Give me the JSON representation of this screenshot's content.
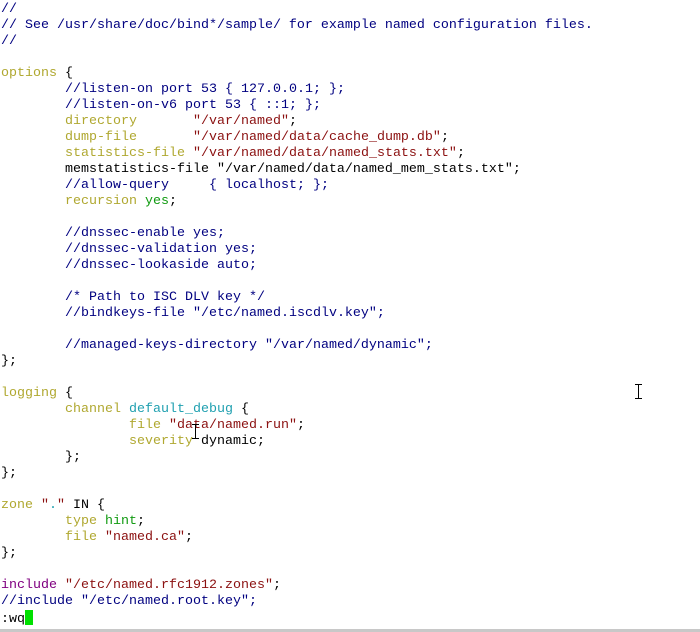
{
  "colors": {
    "n": "#000000",
    "cm": "#000080",
    "kw": "#b0a830",
    "st": "#8b1010",
    "ty": "#109a10",
    "id": "#20a0b0",
    "pp": "#800080",
    "cursor": "#00e000"
  },
  "editor": {
    "lines": [
      [
        [
          "cm",
          "//"
        ]
      ],
      [
        [
          "cm",
          "// See /usr/share/doc/bind*/sample/ for example named configuration files."
        ]
      ],
      [
        [
          "cm",
          "//"
        ]
      ],
      [],
      [
        [
          "kw",
          "options"
        ],
        [
          "n",
          " {"
        ]
      ],
      [
        [
          "n",
          "        "
        ],
        [
          "cm",
          "//listen-on port 53 { 127.0.0.1; };"
        ]
      ],
      [
        [
          "n",
          "        "
        ],
        [
          "cm",
          "//listen-on-v6 port 53 { ::1; };"
        ]
      ],
      [
        [
          "n",
          "        "
        ],
        [
          "kw",
          "directory"
        ],
        [
          "n",
          "       "
        ],
        [
          "st",
          "\"/var/named\""
        ],
        [
          "n",
          ";"
        ]
      ],
      [
        [
          "n",
          "        "
        ],
        [
          "kw",
          "dump-file"
        ],
        [
          "n",
          "       "
        ],
        [
          "st",
          "\"/var/named/data/cache_dump.db\""
        ],
        [
          "n",
          ";"
        ]
      ],
      [
        [
          "n",
          "        "
        ],
        [
          "kw",
          "statistics-file"
        ],
        [
          "n",
          " "
        ],
        [
          "st",
          "\"/var/named/data/named_stats.txt\""
        ],
        [
          "n",
          ";"
        ]
      ],
      [
        [
          "n",
          "        memstatistics-file \"/var/named/data/named_mem_stats.txt\";"
        ]
      ],
      [
        [
          "n",
          "        "
        ],
        [
          "cm",
          "//allow-query     { localhost; };"
        ]
      ],
      [
        [
          "n",
          "        "
        ],
        [
          "kw",
          "recursion"
        ],
        [
          "n",
          " "
        ],
        [
          "ty",
          "yes"
        ],
        [
          "n",
          ";"
        ]
      ],
      [],
      [
        [
          "n",
          "        "
        ],
        [
          "cm",
          "//dnssec-enable yes;"
        ]
      ],
      [
        [
          "n",
          "        "
        ],
        [
          "cm",
          "//dnssec-validation yes;"
        ]
      ],
      [
        [
          "n",
          "        "
        ],
        [
          "cm",
          "//dnssec-lookaside auto;"
        ]
      ],
      [],
      [
        [
          "n",
          "        "
        ],
        [
          "cm",
          "/* Path to ISC DLV key */"
        ]
      ],
      [
        [
          "n",
          "        "
        ],
        [
          "cm",
          "//bindkeys-file \"/etc/named.iscdlv.key\";"
        ]
      ],
      [],
      [
        [
          "n",
          "        "
        ],
        [
          "cm",
          "//managed-keys-directory \"/var/named/dynamic\";"
        ]
      ],
      [
        [
          "n",
          "};"
        ]
      ],
      [],
      [
        [
          "kw",
          "logging"
        ],
        [
          "n",
          " {"
        ]
      ],
      [
        [
          "n",
          "        "
        ],
        [
          "kw",
          "channel"
        ],
        [
          "n",
          " "
        ],
        [
          "id",
          "default_debug"
        ],
        [
          "n",
          " {"
        ]
      ],
      [
        [
          "n",
          "                "
        ],
        [
          "kw",
          "file"
        ],
        [
          "n",
          " "
        ],
        [
          "st",
          "\"data/named.run\""
        ],
        [
          "n",
          ";"
        ]
      ],
      [
        [
          "n",
          "                "
        ],
        [
          "kw",
          "severity"
        ],
        [
          "n",
          " dynamic;"
        ]
      ],
      [
        [
          "n",
          "        };"
        ]
      ],
      [
        [
          "n",
          "};"
        ]
      ],
      [],
      [
        [
          "kw",
          "zone"
        ],
        [
          "n",
          " "
        ],
        [
          "st",
          "\""
        ],
        [
          "id",
          "."
        ],
        [
          "st",
          "\""
        ],
        [
          "n",
          " IN {"
        ]
      ],
      [
        [
          "n",
          "        "
        ],
        [
          "kw",
          "type"
        ],
        [
          "n",
          " "
        ],
        [
          "ty",
          "hint"
        ],
        [
          "n",
          ";"
        ]
      ],
      [
        [
          "n",
          "        "
        ],
        [
          "kw",
          "file"
        ],
        [
          "n",
          " "
        ],
        [
          "st",
          "\"named.ca\""
        ],
        [
          "n",
          ";"
        ]
      ],
      [
        [
          "n",
          "};"
        ]
      ],
      [],
      [
        [
          "pp",
          "include"
        ],
        [
          "n",
          " "
        ],
        [
          "st",
          "\"/etc/named.rfc1912.zones\""
        ],
        [
          "n",
          ";"
        ]
      ],
      [
        [
          "cm",
          "//include \"/etc/named.root.key\";"
        ]
      ],
      [
        [
          "n",
          ":wq"
        ]
      ]
    ]
  }
}
